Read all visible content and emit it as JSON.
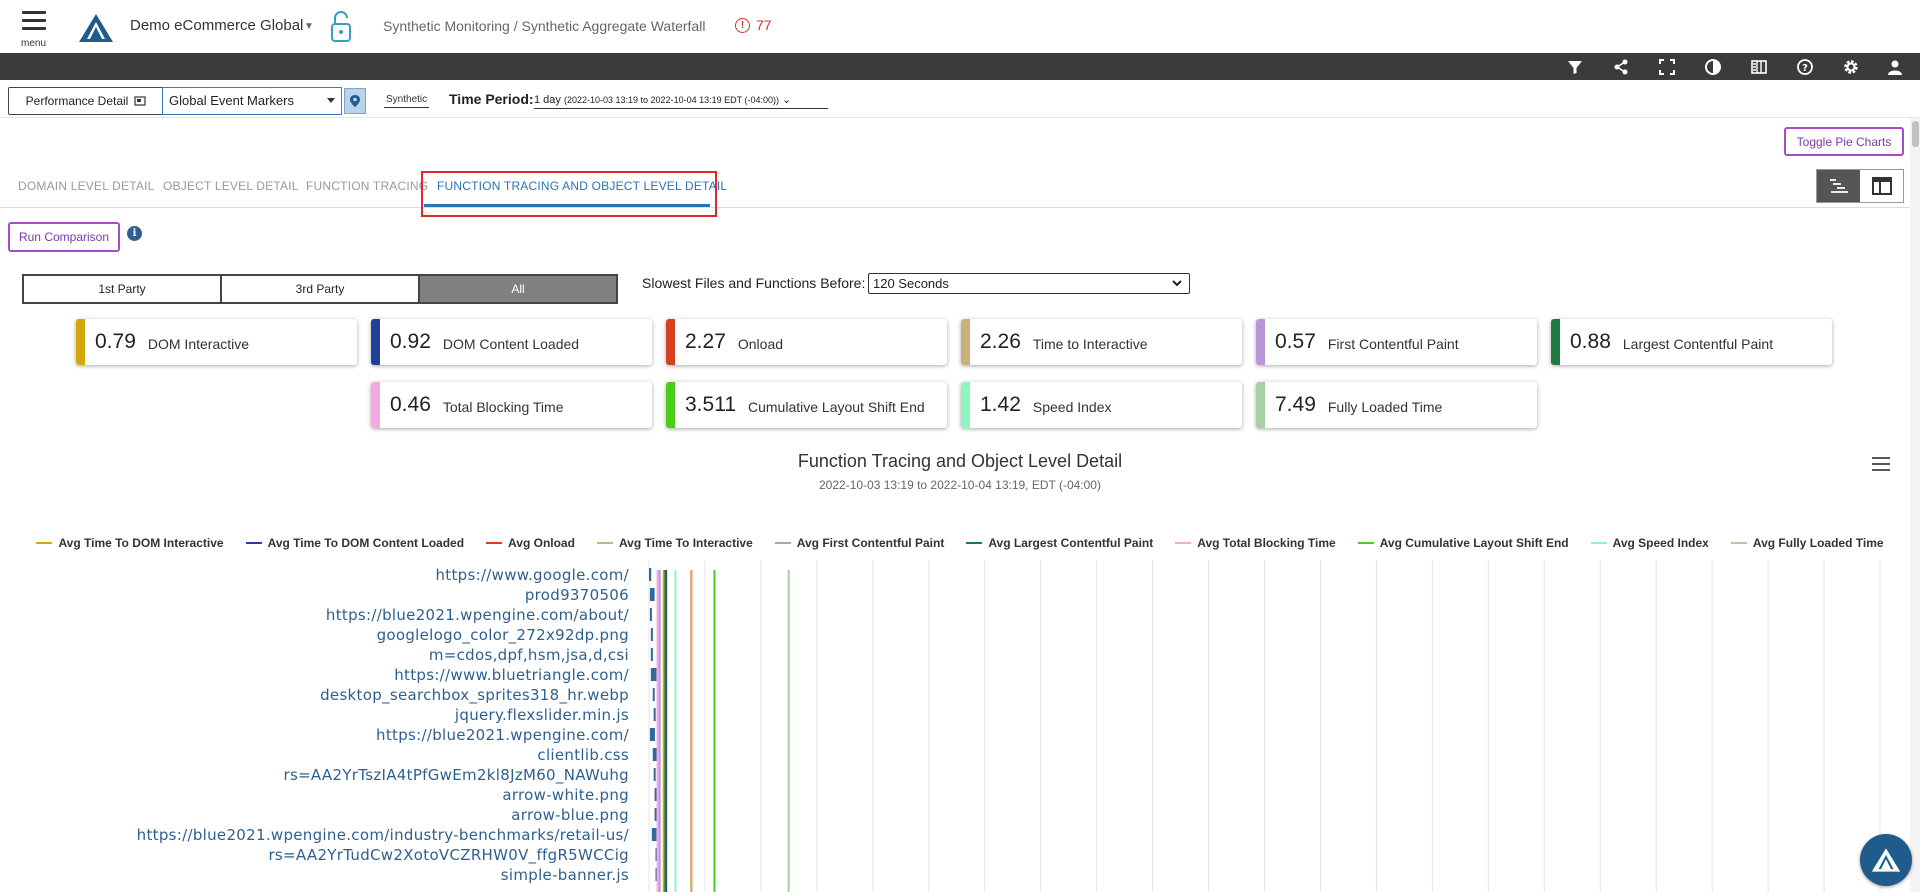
{
  "header": {
    "menu_label": "menu",
    "app_title": "Demo eCommerce Global",
    "breadcrumb": "Synthetic Monitoring / Synthetic Aggregate Waterfall",
    "alert_count": "77"
  },
  "toolbar_icons": [
    "filter-icon",
    "share-icon",
    "fullscreen-icon",
    "contrast-icon",
    "columns-icon",
    "help-icon",
    "gear-icon",
    "user-icon"
  ],
  "filters": {
    "performance_detail": "Performance Detail",
    "event_markers": "Global Event Markers",
    "synthetic_tag": "Synthetic",
    "time_period_label": "Time Period:",
    "time_period_value": "1 day",
    "time_period_range": "(2022-10-03 13:19 to 2022-10-04 13:19 EDT (-04:00))"
  },
  "toggle_pie_label": "Toggle Pie Charts",
  "tabs": [
    {
      "label": "DOMAIN LEVEL DETAIL",
      "active": false
    },
    {
      "label": "OBJECT LEVEL DETAIL",
      "active": false
    },
    {
      "label": "FUNCTION TRACING",
      "active": false
    },
    {
      "label": "FUNCTION TRACING AND OBJECT LEVEL DETAIL",
      "active": true
    }
  ],
  "run_comparison_label": "Run Comparison",
  "party": {
    "options": [
      "1st Party",
      "3rd Party",
      "All"
    ],
    "selected": "All"
  },
  "slowest": {
    "label": "Slowest Files and Functions Before:",
    "value": "120 Seconds"
  },
  "metrics": [
    {
      "value": "0.79",
      "label": "DOM Interactive",
      "color": "#d4a80b"
    },
    {
      "value": "0.92",
      "label": "DOM Content Loaded",
      "color": "#1e3f9e"
    },
    {
      "value": "2.27",
      "label": "Onload",
      "color": "#d7401f"
    },
    {
      "value": "2.26",
      "label": "Time to Interactive",
      "color": "#c9b27a"
    },
    {
      "value": "0.57",
      "label": "First Contentful Paint",
      "color": "#b797d8"
    },
    {
      "value": "0.88",
      "label": "Largest Contentful Paint",
      "color": "#1e7a3e"
    },
    {
      "value": "0.46",
      "label": "Total Blocking Time",
      "color": "#f7a8e4"
    },
    {
      "value": "3.511",
      "label": "Cumulative Layout Shift End",
      "color": "#4ccd1a"
    },
    {
      "value": "1.42",
      "label": "Speed Index",
      "color": "#8ff5c0"
    },
    {
      "value": "7.49",
      "label": "Fully Loaded Time",
      "color": "#a9cfa4"
    }
  ],
  "chart_data": {
    "type": "bar",
    "title": "Function Tracing and Object Level Detail",
    "subtitle": "2022-10-03 13:19 to 2022-10-04 13:19, EDT (-04:00)",
    "legend_placement": "top",
    "markers": [
      {
        "name": "Avg Time To DOM Interactive",
        "value": 0.79,
        "color": "#d4a80b"
      },
      {
        "name": "Avg Time To DOM Content Loaded",
        "value": 0.92,
        "color": "#1e3f9e"
      },
      {
        "name": "Avg Onload",
        "value": 2.27,
        "color": "#d7401f"
      },
      {
        "name": "Avg Time To Interactive",
        "value": 2.26,
        "color": "#c9b27a"
      },
      {
        "name": "Avg First Contentful Paint",
        "value": 0.57,
        "color": "#b797d8"
      },
      {
        "name": "Avg Largest Contentful Paint",
        "value": 0.88,
        "color": "#1e7a3e"
      },
      {
        "name": "Avg Total Blocking Time",
        "value": 0.46,
        "color": "#f7a8e4"
      },
      {
        "name": "Avg Cumulative Layout Shift End",
        "value": 3.511,
        "color": "#4ccd1a"
      },
      {
        "name": "Avg Speed Index",
        "value": 1.42,
        "color": "#8ff5c0"
      },
      {
        "name": "Avg Fully Loaded Time",
        "value": 7.49,
        "color": "#a9cfa4"
      }
    ],
    "categories": [
      "https://www.google.com/",
      "prod9370506",
      "https://blue2021.wpengine.com/about/",
      "googlelogo_color_272x92dp.png",
      "m=cdos,dpf,hsm,jsa,d,csi",
      "https://www.bluetriangle.com/",
      "desktop_searchbox_sprites318_hr.webp",
      "jquery.flexslider.min.js",
      "https://blue2021.wpengine.com/",
      "clientlib.css",
      "rs=AA2YrTszIA4tPfGwEm2kl8JzM60_NAWuhg",
      "arrow-white.png",
      "arrow-blue.png",
      "https://blue2021.wpengine.com/industry-benchmarks/retail-us/",
      "rs=AA2YrTudCw2XotoVCZRHW0V_ffgR5WCCig",
      "simple-banner.js"
    ],
    "bars": [
      {
        "start": 0.0,
        "end": 0.12
      },
      {
        "start": 0.05,
        "end": 0.3
      },
      {
        "start": 0.05,
        "end": 0.12
      },
      {
        "start": 0.1,
        "end": 0.16
      },
      {
        "start": 0.1,
        "end": 0.15
      },
      {
        "start": 0.1,
        "end": 0.4
      },
      {
        "start": 0.2,
        "end": 0.26
      },
      {
        "start": 0.25,
        "end": 0.32
      },
      {
        "start": 0.05,
        "end": 0.32
      },
      {
        "start": 0.2,
        "end": 0.42
      },
      {
        "start": 0.25,
        "end": 0.34
      },
      {
        "start": 0.3,
        "end": 0.35
      },
      {
        "start": 0.3,
        "end": 0.35
      },
      {
        "start": 0.15,
        "end": 0.4
      },
      {
        "start": 0.35,
        "end": 0.42
      },
      {
        "start": 0.35,
        "end": 0.42
      }
    ],
    "xlim": [
      0,
      66
    ],
    "grid": true
  }
}
